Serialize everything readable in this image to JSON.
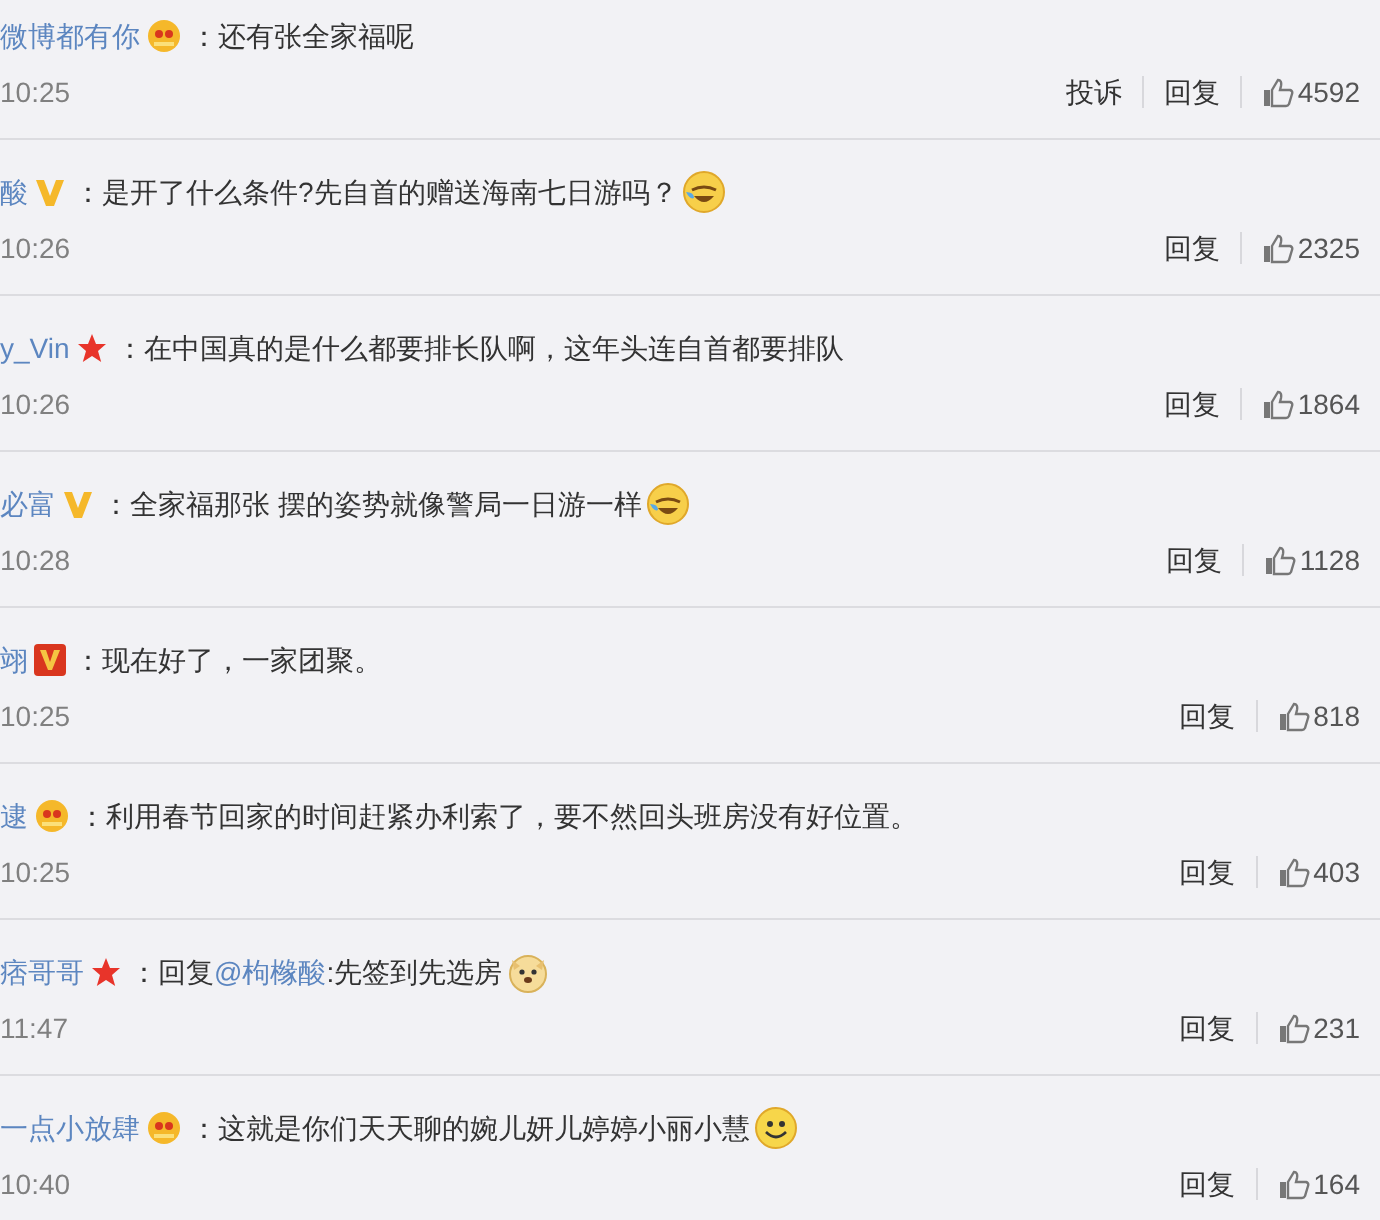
{
  "comments": [
    {
      "user": "微博都有你",
      "badge": {
        "kind": "crown"
      },
      "text": "：还有张全家福呢",
      "time": "10:25",
      "actions": [
        "投诉",
        "回复"
      ],
      "likes": "4592"
    },
    {
      "user": "酸",
      "badge": {
        "kind": "v-gold"
      },
      "text": "：是开了什么条件?先自首的赠送海南七日游吗？",
      "emoji": {
        "kind": "laugh-cry"
      },
      "time": "10:26",
      "actions": [
        "回复"
      ],
      "likes": "2325"
    },
    {
      "user": "y_Vin",
      "badge": {
        "kind": "star"
      },
      "text": "：在中国真的是什么都要排长队啊，这年头连自首都要排队",
      "time": "10:26",
      "actions": [
        "回复"
      ],
      "likes": "1864"
    },
    {
      "user": "必富",
      "badge": {
        "kind": "v-gold"
      },
      "text": "：全家福那张 摆的姿势就像警局一日游一样",
      "emoji": {
        "kind": "laugh-cry"
      },
      "time": "10:28",
      "actions": [
        "回复"
      ],
      "likes": "1128"
    },
    {
      "user": "翊",
      "badge": {
        "kind": "v-red"
      },
      "text": "：现在好了，一家团聚。",
      "time": "10:25",
      "actions": [
        "回复"
      ],
      "likes": "818"
    },
    {
      "user": "逮",
      "badge": {
        "kind": "crown"
      },
      "text": "：利用春节回家的时间赶紧办利索了，要不然回头班房没有好位置。",
      "time": "10:25",
      "actions": [
        "回复"
      ],
      "likes": "403"
    },
    {
      "user": "痞哥哥",
      "badge": {
        "kind": "star"
      },
      "reply_prefix": "：回复",
      "mention": "@枸橼酸",
      "text": ":先签到先选房",
      "emoji": {
        "kind": "doge"
      },
      "time": "11:47",
      "actions": [
        "回复"
      ],
      "likes": "231"
    },
    {
      "user": "一点小放肆",
      "badge": {
        "kind": "crown"
      },
      "text": "：这就是你们天天聊的婉儿妍儿婷婷小丽小慧",
      "emoji": {
        "kind": "smile"
      },
      "time": "10:40",
      "actions": [
        "回复"
      ],
      "likes": "164"
    }
  ]
}
